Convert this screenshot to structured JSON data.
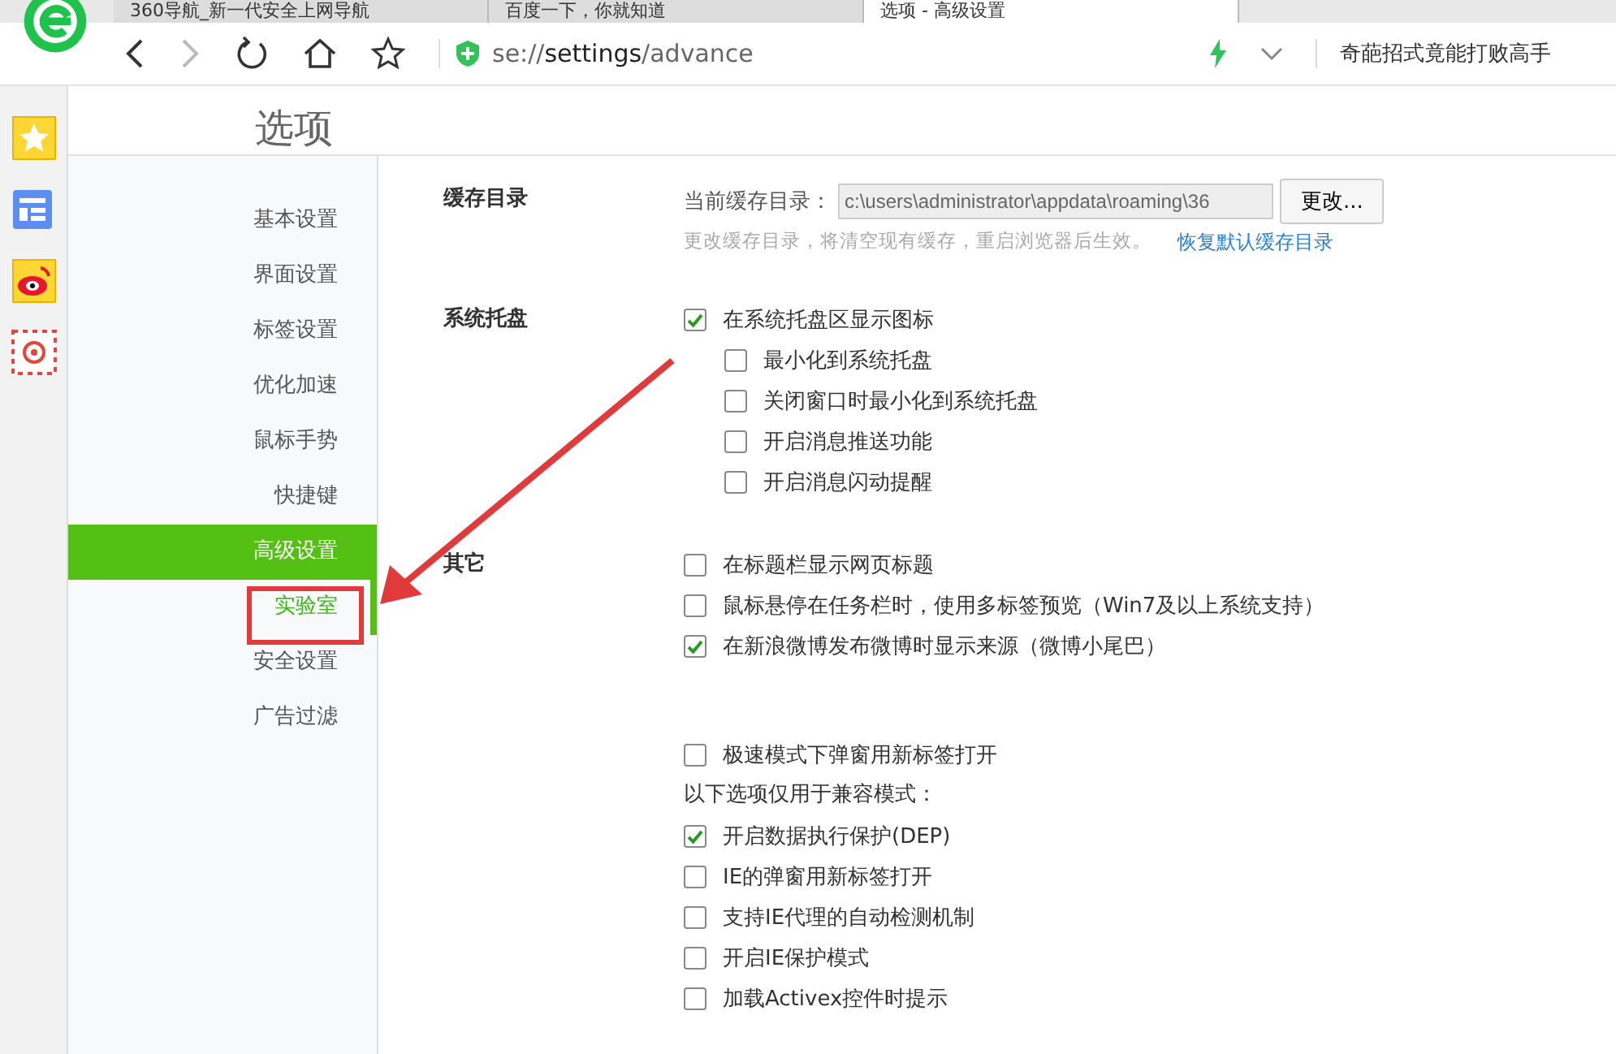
{
  "tabs": [
    {
      "title": "360导航_新一代安全上网导航",
      "selected": false
    },
    {
      "title": "百度一下，你就知道",
      "selected": false
    },
    {
      "title": "选项 - 高级设置",
      "selected": true
    }
  ],
  "address_bar": {
    "scheme": "se://",
    "host": "settings",
    "path": "/advance"
  },
  "search_box": {
    "value": "奇葩招式竟能打败高手"
  },
  "page_title": "选项",
  "nav": [
    {
      "label": "基本设置",
      "selected": false,
      "highlighted": false
    },
    {
      "label": "界面设置",
      "selected": false,
      "highlighted": false
    },
    {
      "label": "标签设置",
      "selected": false,
      "highlighted": false
    },
    {
      "label": "优化加速",
      "selected": false,
      "highlighted": false
    },
    {
      "label": "鼠标手势",
      "selected": false,
      "highlighted": false
    },
    {
      "label": "快捷键",
      "selected": false,
      "highlighted": false
    },
    {
      "label": "高级设置",
      "selected": true,
      "highlighted": false
    },
    {
      "label": "实验室",
      "selected": false,
      "highlighted": true
    },
    {
      "label": "安全设置",
      "selected": false,
      "highlighted": false
    },
    {
      "label": "广告过滤",
      "selected": false,
      "highlighted": false
    }
  ],
  "cache": {
    "heading": "缓存目录",
    "label": "当前缓存目录：",
    "value": "c:\\users\\administrator\\appdata\\roaming\\36",
    "button": "更改...",
    "note": "更改缓存目录，将清空现有缓存，重启浏览器后生效。",
    "link": "恢复默认缓存目录"
  },
  "sections": [
    {
      "heading": "系统托盘",
      "items": [
        {
          "kind": "checkbox",
          "label": "在系统托盘区显示图标",
          "checked": true,
          "children": [
            {
              "kind": "checkbox",
              "label": "最小化到系统托盘",
              "checked": false
            },
            {
              "kind": "checkbox",
              "label": "关闭窗口时最小化到系统托盘",
              "checked": false
            },
            {
              "kind": "checkbox",
              "label": "开启消息推送功能",
              "checked": false
            },
            {
              "kind": "checkbox",
              "label": "开启消息闪动提醒",
              "checked": false
            }
          ]
        }
      ]
    },
    {
      "heading": "其它",
      "items": [
        {
          "kind": "checkbox",
          "label": "在标题栏显示网页标题",
          "checked": false
        },
        {
          "kind": "checkbox",
          "label": "鼠标悬停在任务栏时，使用多标签预览（Win7及以上系统支持）",
          "checked": false
        },
        {
          "kind": "checkbox",
          "label": "在新浪微博发布微博时显示来源（微博小尾巴）",
          "checked": true
        },
        {
          "kind": "spacer"
        },
        {
          "kind": "checkbox",
          "label": "极速模式下弹窗用新标签打开",
          "checked": false
        },
        {
          "kind": "note",
          "label": "以下选项仅用于兼容模式："
        },
        {
          "kind": "checkbox",
          "label": "开启数据执行保护(DEP)",
          "checked": true
        },
        {
          "kind": "checkbox",
          "label": "IE的弹窗用新标签打开",
          "checked": false
        },
        {
          "kind": "checkbox",
          "label": "支持IE代理的自动检测机制",
          "checked": false
        },
        {
          "kind": "checkbox",
          "label": "开启IE保护模式",
          "checked": false
        },
        {
          "kind": "checkbox",
          "label": "加载Activex控件时提示",
          "checked": false
        }
      ]
    }
  ]
}
